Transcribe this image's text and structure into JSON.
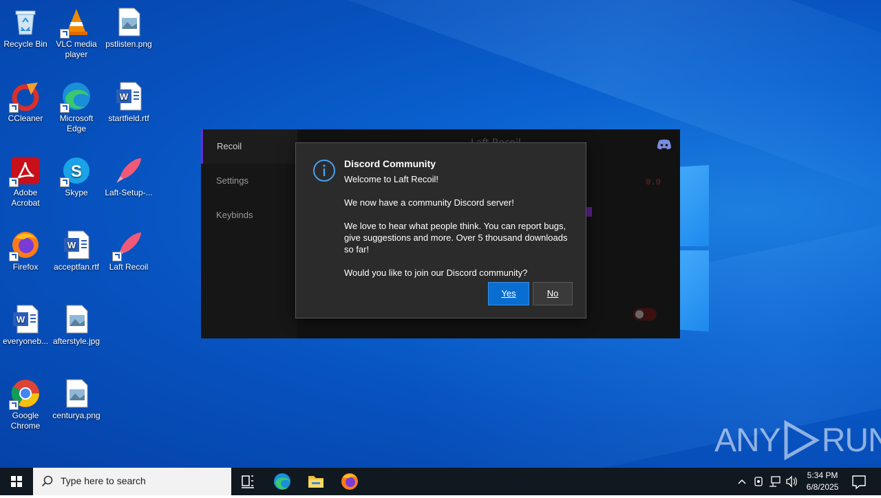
{
  "desktop": {
    "icons": [
      {
        "label": "Recycle Bin",
        "icon": "recycle-bin-icon"
      },
      {
        "label": "VLC media player",
        "icon": "vlc-icon"
      },
      {
        "label": "pstlisten.png",
        "icon": "image-file-icon"
      },
      {
        "label": "CCleaner",
        "icon": "ccleaner-icon"
      },
      {
        "label": "Microsoft Edge",
        "icon": "edge-icon"
      },
      {
        "label": "startfield.rtf",
        "icon": "word-doc-icon"
      },
      {
        "label": "Adobe Acrobat",
        "icon": "acrobat-icon"
      },
      {
        "label": "Skype",
        "icon": "skype-icon"
      },
      {
        "label": "Laft-Setup-...",
        "icon": "rocket-icon"
      },
      {
        "label": "Firefox",
        "icon": "firefox-icon"
      },
      {
        "label": "acceptfan.rtf",
        "icon": "word-doc-icon"
      },
      {
        "label": "Laft Recoil",
        "icon": "rocket-icon"
      },
      {
        "label": "everyoneb...",
        "icon": "word-doc-icon"
      },
      {
        "label": "afterstyle.jpg",
        "icon": "image-file-icon"
      },
      {
        "label": "Google Chrome",
        "icon": "chrome-icon"
      },
      {
        "label": "centurya.png",
        "icon": "image-file-icon"
      }
    ]
  },
  "app": {
    "title": "Laft Recoil",
    "nav": [
      {
        "label": "Recoil"
      },
      {
        "label": "Settings"
      },
      {
        "label": "Keybinds"
      }
    ],
    "value": "0.0"
  },
  "dialog": {
    "title": "Discord Community",
    "lines": [
      "Welcome to Laft Recoil!",
      "We now have a community Discord server!",
      "We love to hear what people think. You can report bugs, give suggestions and more. Over 5 thousand downloads so far!",
      "Would you like to join our Discord community?"
    ],
    "yes_label": "Yes",
    "no_label": "No",
    "accent": "#0a6ed1"
  },
  "watermark": {
    "left": "ANY",
    "right": "RUN"
  },
  "taskbar": {
    "search_placeholder": "Type here to search",
    "time": "5:34 PM",
    "date": "6/8/2025"
  }
}
